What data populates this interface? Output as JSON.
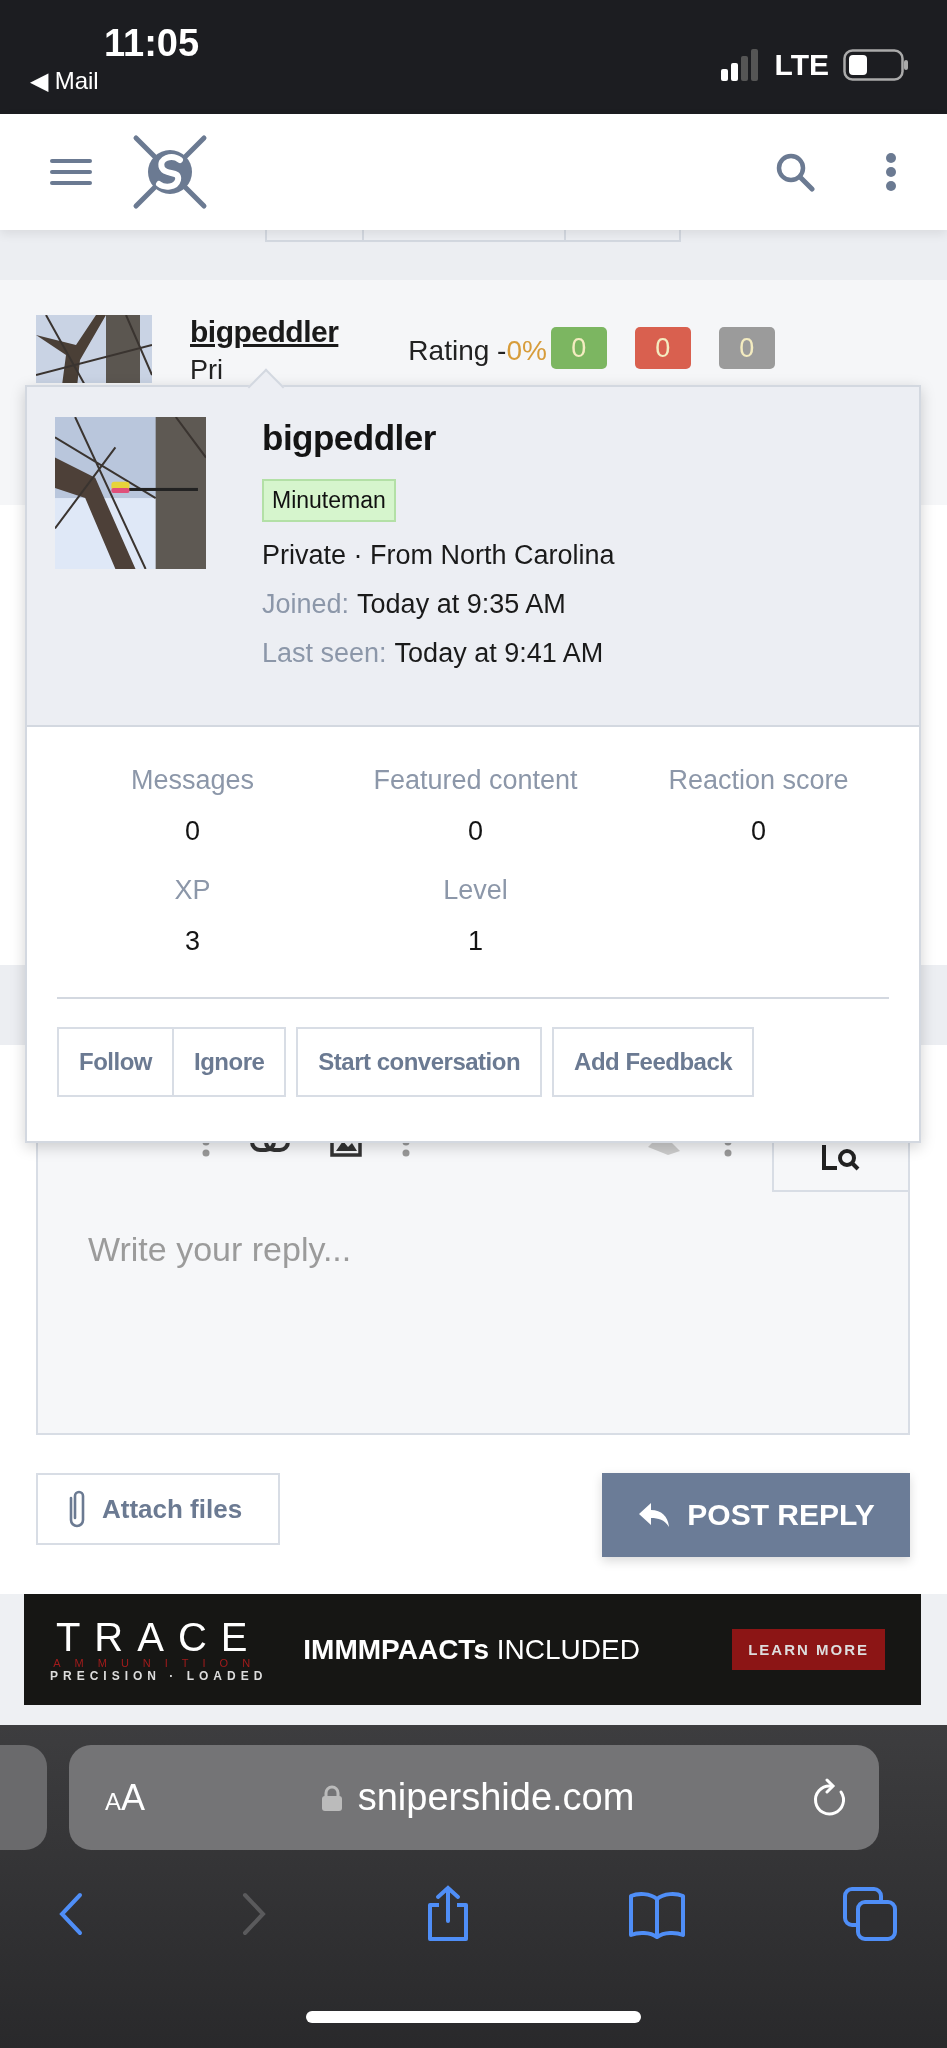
{
  "status_bar": {
    "time": "11:05",
    "back_app": "◀ Mail",
    "network": "LTE"
  },
  "post": {
    "username": "bigpeddler",
    "user_title": "Pri",
    "rating_label": "Rating -",
    "rating_percent": "0%",
    "rating_counts": [
      {
        "value": "0",
        "color": "#7cb661"
      },
      {
        "value": "0",
        "color": "#d9604f"
      },
      {
        "value": "0",
        "color": "#9b9b9b"
      }
    ]
  },
  "popover": {
    "username": "bigpeddler",
    "banner": "Minuteman",
    "info": "Private · From North Carolina",
    "details": [
      {
        "label": "Joined:",
        "value": "Today at 9:35 AM"
      },
      {
        "label": "Last seen:",
        "value": "Today at 9:41 AM"
      }
    ],
    "stats": [
      {
        "label": "Messages",
        "value": "0"
      },
      {
        "label": "Featured content",
        "value": "0"
      },
      {
        "label": "Reaction score",
        "value": "0"
      },
      {
        "label": "XP",
        "value": "3"
      },
      {
        "label": "Level",
        "value": "1"
      }
    ],
    "actions": [
      [
        "Follow",
        "Ignore"
      ],
      [
        "Start conversation"
      ],
      [
        "Add Feedback"
      ]
    ]
  },
  "editor": {
    "placeholder": "Write your reply..."
  },
  "attach_button": "Attach files",
  "post_button": "POST REPLY",
  "ad": {
    "brand": "TRACE",
    "brand_sub": "AMMUNITION",
    "tagline": "PRECISION · LOADED",
    "headline": "**IMMMPAACTs** INCLUDED",
    "cta": "LEARN MORE"
  },
  "browser": {
    "text_size": "AA",
    "url": "snipershide.com"
  }
}
